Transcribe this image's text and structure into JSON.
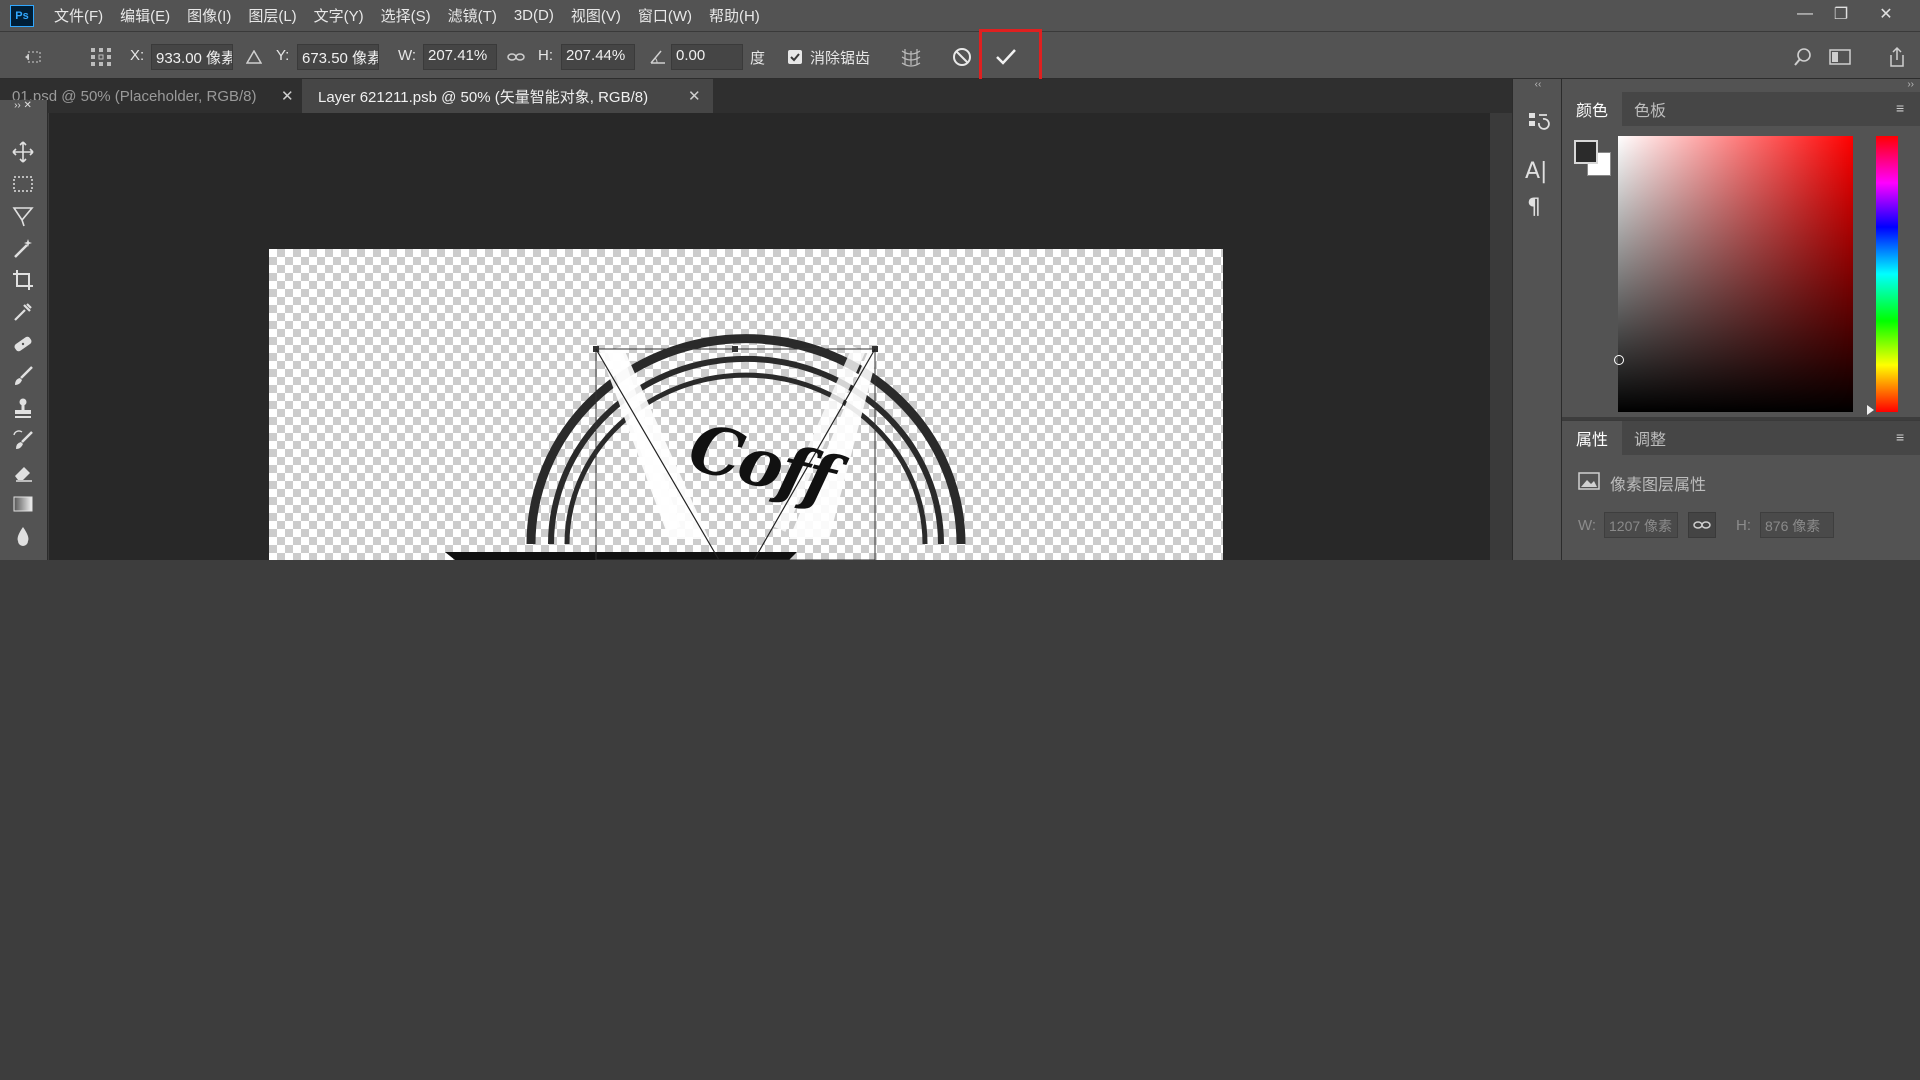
{
  "app": {
    "logo_text": "Ps",
    "menu": [
      "文件(F)",
      "编辑(E)",
      "图像(I)",
      "图层(L)",
      "文字(Y)",
      "选择(S)",
      "滤镜(T)",
      "3D(D)",
      "视图(V)",
      "窗口(W)",
      "帮助(H)"
    ],
    "window_controls": {
      "minimize": "—",
      "restore": "❐",
      "close": "✕"
    }
  },
  "options_bar": {
    "x_label": "X:",
    "x_value": "933.00 像素",
    "y_label": "Y:",
    "y_value": "673.50 像素",
    "w_label": "W:",
    "w_value": "207.41%",
    "h_label": "H:",
    "h_value": "207.44%",
    "angle_value": "0.00",
    "angle_unit": "度",
    "antialias_label": "消除锯齿",
    "antialias_checked": true
  },
  "tabs": [
    {
      "label": "01.psd @ 50% (Placeholder, RGB/8)",
      "active": false
    },
    {
      "label": "Layer 621211.psb @ 50% (矢量智能对象, RGB/8)",
      "active": true
    }
  ],
  "tools": [
    "move-icon",
    "marquee-icon",
    "lasso-icon",
    "magic-wand-icon",
    "crop-icon",
    "eyedropper-icon",
    "healing-icon",
    "brush-icon",
    "stamp-icon",
    "history-brush-icon",
    "eraser-icon",
    "gradient-icon",
    "blur-icon"
  ],
  "color_panel": {
    "tabs": [
      "颜色",
      "色板"
    ],
    "active_tab": "颜色",
    "hue_color": "#ff0000",
    "foreground": "#2b2b2b",
    "background": "#ffffff"
  },
  "properties_panel": {
    "tabs": [
      "属性",
      "调整"
    ],
    "active_tab": "属性",
    "title": "像素图层属性",
    "w_label": "W:",
    "w_value": "1207 像素",
    "h_label": "H:",
    "h_value": "876 像素"
  },
  "canvas": {
    "logo_text": "Coff"
  },
  "colors": {
    "ui_panel": "#535353",
    "ui_dark": "#282828",
    "highlight": "#e02020"
  }
}
